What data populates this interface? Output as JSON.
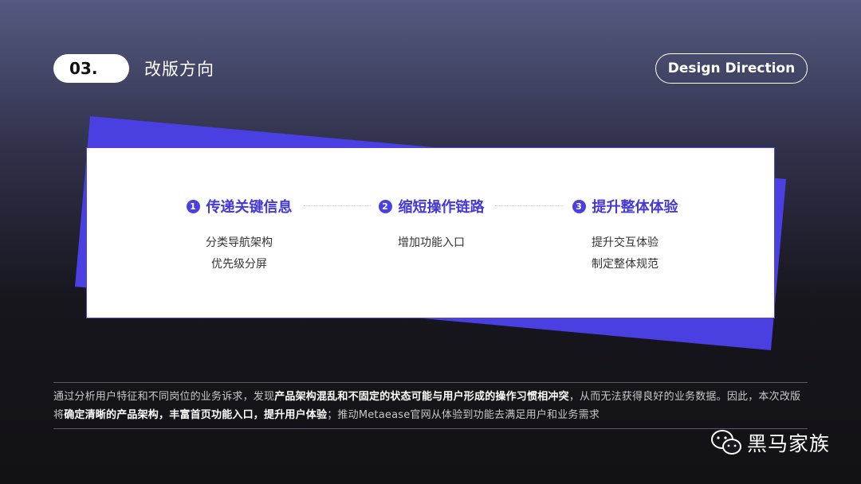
{
  "header": {
    "badge": "03.",
    "title": "改版方向",
    "english_label": "Design Direction"
  },
  "colors": {
    "accent": "#4a3fe0",
    "card_bg": "#ffffff"
  },
  "directions": [
    {
      "number": "1",
      "title": "传递关键信息",
      "items": [
        "分类导航架构",
        "优先级分屏"
      ]
    },
    {
      "number": "2",
      "title": "缩短操作链路",
      "items": [
        "增加功能入口"
      ]
    },
    {
      "number": "3",
      "title": "提升整体体验",
      "items": [
        "提升交互体验",
        "制定整体规范"
      ]
    }
  ],
  "summary": {
    "p1": "通过分析用户特征和不同岗位的业务诉求，发现",
    "b1": "产品架构混乱和不固定的状态可能与用户形成的操作习惯相冲突",
    "p2": "，从而无法获得良好的业务数据。因此，本次改版将",
    "b2": "确定清晰的产品架构，丰富首页功能入口，提升用户体验",
    "p3": "；推动Metaease官网从体验到功能去满足用户和业务需求"
  },
  "brand": {
    "icon": "wechat-icon",
    "name": "黑马家族"
  }
}
